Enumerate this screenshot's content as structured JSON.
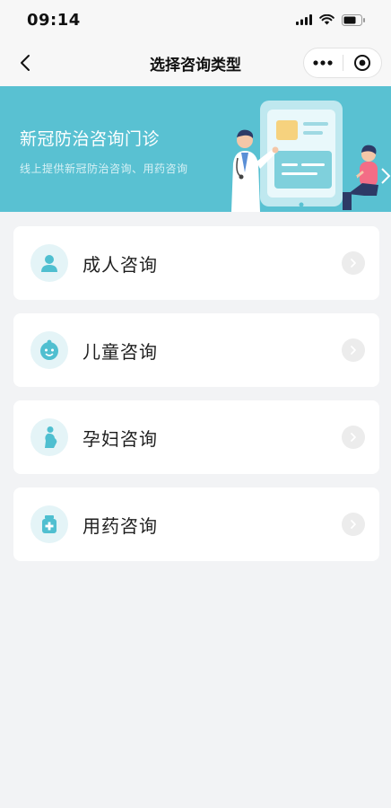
{
  "status_bar": {
    "time": "09:14"
  },
  "nav": {
    "title": "选择咨询类型"
  },
  "banner": {
    "title": "新冠防治咨询门诊",
    "subtitle": "线上提供新冠防治咨询、用药咨询"
  },
  "options": [
    {
      "label": "成人咨询",
      "icon": "adult-icon"
    },
    {
      "label": "儿童咨询",
      "icon": "child-icon"
    },
    {
      "label": "孕妇咨询",
      "icon": "pregnant-icon"
    },
    {
      "label": "用药咨询",
      "icon": "medicine-icon"
    }
  ],
  "colors": {
    "banner_bg": "#59c1d2",
    "icon_bg": "#e4f4f7",
    "icon_accent": "#4fbfd0",
    "page_bg": "#f2f3f5"
  }
}
